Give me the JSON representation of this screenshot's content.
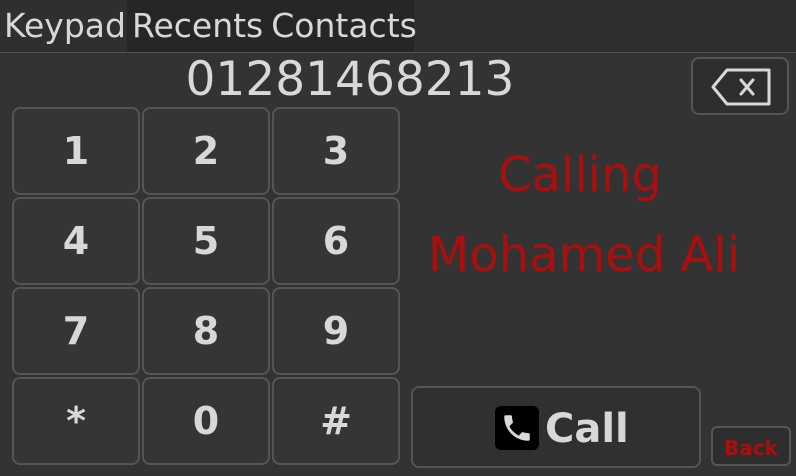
{
  "tabs": {
    "keypad": "Keypad",
    "recents": "Recents",
    "contacts": "Contacts"
  },
  "dialed_number": "01281468213",
  "keypad": {
    "keys": [
      "1",
      "2",
      "3",
      "4",
      "5",
      "6",
      "7",
      "8",
      "9",
      "*",
      "0",
      "#"
    ]
  },
  "call_status": {
    "label": "Calling",
    "name": "Mohamed Ali",
    "color": "#a80f0f"
  },
  "call_button": {
    "label": "Call",
    "icon": "phone-icon"
  },
  "backspace_button": {
    "icon": "backspace-icon"
  },
  "back_button": {
    "label": "Back"
  },
  "colors": {
    "background": "#333333",
    "accent_red": "#a80f0f",
    "text": "#d8d8d8",
    "border": "#555555"
  }
}
